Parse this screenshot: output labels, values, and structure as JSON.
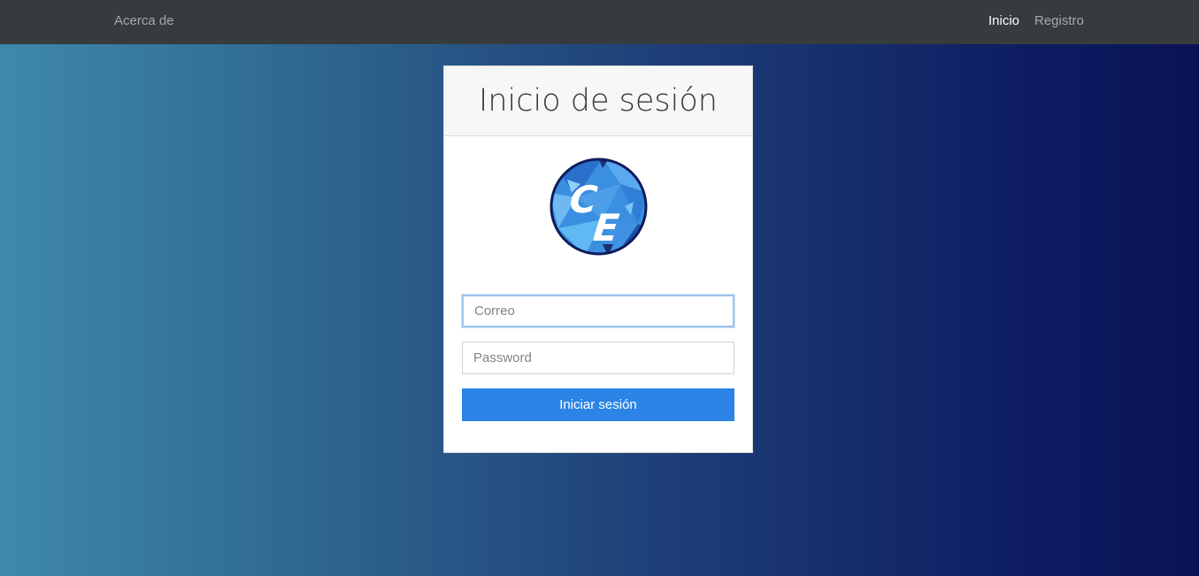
{
  "navbar": {
    "about_label": "Acerca de",
    "home_label": "Inicio",
    "register_label": "Registro"
  },
  "login": {
    "title": "Inicio de sesión",
    "logo_text": "CE",
    "email_placeholder": "Correo",
    "password_placeholder": "Password",
    "submit_label": "Iniciar sesión"
  },
  "colors": {
    "navbar_bg": "#373b3e",
    "button_bg": "#2b84e6",
    "gradient_left": "#3e89ab",
    "gradient_right": "#0a1256"
  }
}
